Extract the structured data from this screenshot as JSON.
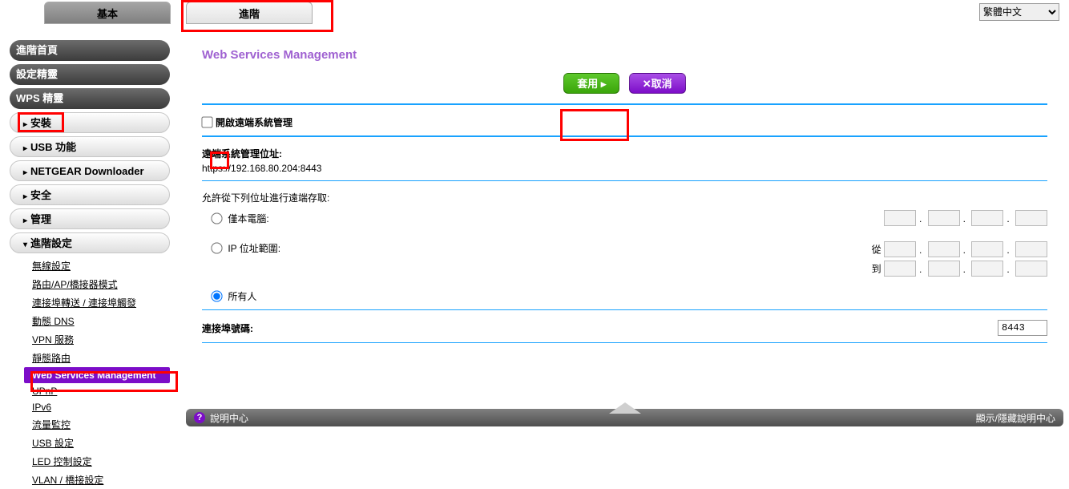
{
  "lang": {
    "selected": "繁體中文"
  },
  "tabs": {
    "basic": "基本",
    "advanced": "進階"
  },
  "sidebar": {
    "top": [
      "進階首頁",
      "設定精靈",
      "WPS 精靈"
    ],
    "sections": [
      {
        "label": "安裝"
      },
      {
        "label": "USB 功能"
      },
      {
        "label": "NETGEAR Downloader"
      },
      {
        "label": "安全"
      },
      {
        "label": "管理"
      },
      {
        "label": "進階設定",
        "open": true
      }
    ],
    "sub": [
      "無線設定",
      "路由/AP/橋接器模式",
      "連接埠轉送 / 連接埠觸發",
      "動態 DNS",
      "VPN 服務",
      "靜態路由",
      "Web Services Management",
      "UPnP",
      "IPv6",
      "流量監控",
      "USB 設定",
      "LED 控制設定",
      "VLAN / 橋接設定"
    ],
    "sub_selected_index": 6
  },
  "panel": {
    "title": "Web Services Management",
    "apply": "套用 ▸",
    "cancel": "✕取消",
    "enable_label": "開啟遠端系統管理",
    "addr_label": "遠端系統管理位址:",
    "addr_value": "https://192.168.80.204:8443",
    "allow_label": "允許從下列位址進行遠端存取:",
    "opt_this_pc": "僅本電腦:",
    "opt_ip_range": "IP 位址範圍:",
    "from": "從",
    "to": "到",
    "opt_everyone": "所有人",
    "port_label": "連接埠號碼:",
    "port_value": "8443",
    "selected_allow": "everyone"
  },
  "helpbar": {
    "title": "說明中心",
    "toggle": "顯示/隱藏說明中心"
  }
}
